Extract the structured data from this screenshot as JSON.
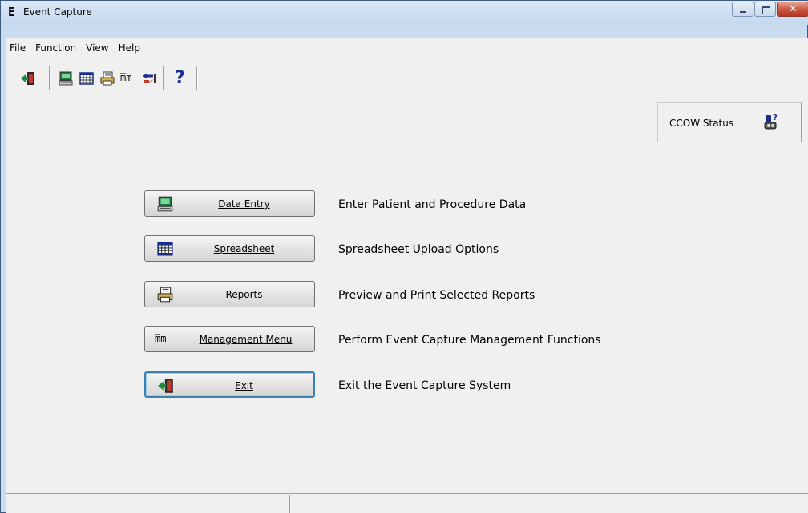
{
  "window": {
    "title": "Event Capture",
    "title_glyph": "E"
  },
  "menu": [
    {
      "label": "File"
    },
    {
      "label": "Function"
    },
    {
      "label": "View"
    },
    {
      "label": "Help"
    }
  ],
  "toolbar": {
    "icons": [
      "exit-door-icon",
      "data-entry-computer-icon",
      "spreadsheet-grid-icon",
      "reports-printer-icon",
      "management-mm-icon",
      "swap-arrows-icon",
      "help-question-icon"
    ],
    "help_glyph": "?",
    "mm_glyph": "m̅m"
  },
  "ccow": {
    "label": "CCOW Status",
    "icon": "ccow-link-icon"
  },
  "actions": [
    {
      "label": "Data Entry",
      "description": "Enter Patient and Procedure Data",
      "icon": "data-entry-computer-icon"
    },
    {
      "label": "Spreadsheet",
      "description": "Spreadsheet Upload Options",
      "icon": "spreadsheet-grid-icon"
    },
    {
      "label": "Reports",
      "description": "Preview and Print Selected Reports",
      "icon": "reports-printer-icon"
    },
    {
      "label": "Management Menu",
      "description": "Perform Event Capture Management Functions",
      "icon": "management-mm-icon"
    },
    {
      "label": "Exit",
      "description": "Exit the Event Capture System",
      "icon": "exit-door-icon"
    }
  ],
  "colors": {
    "accent_blue": "#3c7fb1",
    "frame": "#c9dcf0"
  }
}
